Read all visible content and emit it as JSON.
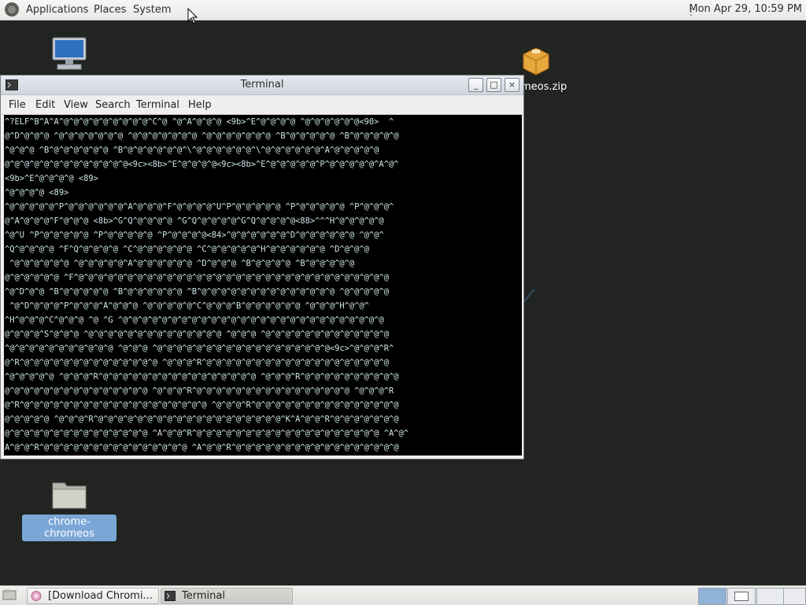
{
  "top_panel": {
    "menus": [
      "Applications",
      "Places",
      "System"
    ],
    "clock": "Mon Apr 29, 10:59 PM"
  },
  "desktop": {
    "icons": [
      {
        "name": "computer-icon",
        "label": ""
      },
      {
        "name": "zip-file-icon",
        "label": "chrome-chromeos.zip",
        "visible_label": "meos.zip"
      },
      {
        "name": "folder-icon",
        "label": "chrome-chromeos"
      }
    ]
  },
  "terminal": {
    "title": "Terminal",
    "buttons": {
      "minimize": "_",
      "maximize": "□",
      "close": "×"
    },
    "menu": [
      "File",
      "Edit",
      "View",
      "Search",
      "Terminal",
      "Help"
    ],
    "lines": [
      "^?ELF^B^A^A^@^@^@^@^@^@^@^@^@^C^@ ^@^A^@^@^@ <9b>^E^@^@^@^@ ^@^@^@^@^@^@<90>  ^",
      "@^D^@^@^@ ^@^@^@^@^@^@^@ ^@^@^@^@^@^@^@ ^@^@^@^@^@^@^@ ^B^@^@^@^@^@ ^B^@^@^@^@^@",
      "^@^@^@ ^B^@^@^@^@^@^@ ^B^@^@^@^@^@^@^\\^@^@^@^@^@^@^\\^@^@^@^@^@^@^A^@^@^@^@^@",
      "@^@^@^@^@^@^@^@^@^@^@^@^@<9c><8b>^E^@^@^@^@<9c><8b>^E^@^@^@^@^@^P^@^@^@^@^@^A^@^",
      "<9b>^E^@^@^@^@ <89>",
      "^@^@^@^@ <89>",
      "^@^@^@^@^@^P^@^@^@^@^@^@^A^@^@^@^F^@^@^@^@^U^P^@^@^@^@^@ ^P^@^@^@^@^@ ^P^@^@^@^",
      "@^A^@^@^@^F^@^@^@ <8b>^G^Q^@^@^@^@ ^G^Q^@^@^@^@^G^Q^@^@^@^@<88>^^^H^@^@^@^@^@",
      "^@^U ^P^@^@^@^@^@ ^P^@^@^@^@^@ ^P^@^@^@^@<84>^@^@^@^@^@^@^D^@^@^@^@^@^@ ^@^@^",
      "^Q^@^@^@^@ ^F^Q^@^@^@^@ ^C^@^@^@^@^@^@ ^C^@^@^@^@^@^H^@^@^@^@^@^@ ^D^@^@^@",
      " ^@^@^@^@^@^@ ^@^@^@^@^@^A^@^@^@^@^@^@ ^D^@^@^@ ^B^@^@^@^@ ^B^@^@^@^@^@",
      "@^@^@^@^@^@ ^F^@^@^@^@^@^@^@^@^@^@^@^@^@^@^@^@^@^@^@^@^@^@^@^@^@^@^@^@^@^@^@^@",
      "^@^D^@^@ ^B^@^@^@^@^@ ^B^@^@^@^@^@^@ ^B^@^@^@^@^@^@^@^@^@^@^@^@^@^@ ^@^@^@^@^@",
      " ^@^D^@^@^@^P^@^@^@^A^@^@^@ ^@^@^@^@^@^C^@^@^@^B^@^@^@^@^@^@ ^@^@^@^H^@^@^",
      "^H^@^@^@^C^@^@^@ ^@ ^G ^@^@^@^@^@^@^@^@^@^@^@^@^@^@^@^@^@^@^@^@^@^@^@^@^@^@^@",
      "@^@^@^@^S^@^@^@ ^@^@^@^@^@^@^@^@^@^@^@^@^@^@ ^@^@^@ ^@^@^@^@^@^@^@^@^@^@^@^@^@",
      "^@^@^@^@^@^@^@^@^@^@^@ ^@^@^@ ^@^@^@^@^@^@^@^@^@^@^@^@^@^@^@^@^@^@<9c>^@^@^@^R^",
      "@^R^@^@^@^@^@^@^@^@^@^@^@^@^@^@ ^@^@^@^R^@^@^@^@^@^@^@^@^@^@^@^@^@^@^@^@^@^@^@",
      "^@^@^@^@^@ ^@^@^@^R^@^@^@^@^@^@^@^@^@^@^@^@^@^@^@^@ ^@^@^@^R^@^@^@^@^@^@^@^@^@^@",
      "@^@^@^@^@^@^@^@^@^@^@^@^@^@^@ ^@^@^@^R^@^@^@^@^@^@^@^@^@^@^@^@^@^@^@^@ ^@^@^@^R",
      "@^R^@^@^@^@^@^@^@^@^@^@^@^@^@^@^@^@^@^@^@ ^@^@^@^R^@^@^@^@^@^@^@^@^@^@^@^@^@^@^@",
      "@^@^@^@^@ ^@^@^@^R^@^@^@^@^@^@^@^@^@^@^@^@^@^@^@^@^@^@^@^K^A^@^@^R^@^@^@^@^@^@^@",
      "@^@^@^@^@^@^@^@^@^@^@^@^@^@^@ ^A^@^@^R^@^@^@^@^@^@^@^@^@^@^@^@^@^@^@^@^@^@^@ ^A^@^",
      "A^@^@^R^@^@^@^@^@^@^@^@^@^@^@^@^@^@^@ ^A^@^@^R^@^@^@^@^@^@^@^@^@^@^@^@^@^@^@^@^@"
    ]
  },
  "taskbar": {
    "tasks": [
      {
        "label": "[Download Chromi...",
        "icon": "firefox-icon"
      },
      {
        "label": "Terminal",
        "icon": "terminal-icon"
      }
    ]
  },
  "colors": {
    "desktop_bg": "#222422",
    "terminal_bg": "#000000",
    "terminal_fg": "#cfe6e8",
    "selection": "#7ba7d6"
  }
}
